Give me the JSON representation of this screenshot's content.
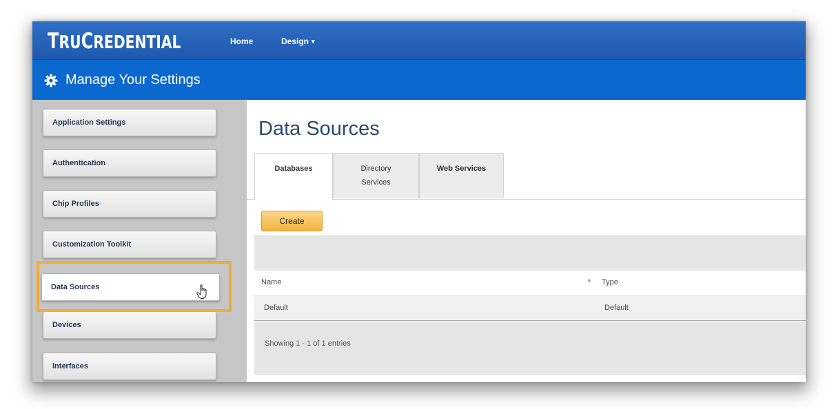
{
  "brand": {
    "prefix_big": "T",
    "part1": "RU",
    "mid_big": "C",
    "part2": "REDENTIAL"
  },
  "nav": {
    "home": "Home",
    "design": "Design",
    "design_caret": "▾"
  },
  "header": {
    "title": "Manage Your Settings",
    "icon": "gear-icon"
  },
  "sidebar": {
    "items": [
      {
        "label": "Application Settings"
      },
      {
        "label": "Authentication"
      },
      {
        "label": "Chip Profiles"
      },
      {
        "label": "Customization Toolkit"
      },
      {
        "label": "Data Sources"
      },
      {
        "label": "Devices"
      },
      {
        "label": "Interfaces"
      }
    ],
    "active_index": 4
  },
  "main": {
    "title": "Data Sources",
    "tabs": [
      {
        "label": "Databases"
      },
      {
        "label_line1": "Directory",
        "label_line2": "Services"
      },
      {
        "label": "Web Services"
      }
    ],
    "create_label": "Create",
    "table": {
      "columns": [
        "Name",
        "Type"
      ],
      "sort_indicator": "▲",
      "rows": [
        {
          "name": "Default",
          "type": "Default"
        }
      ]
    },
    "footer": "Showing 1 - 1 of 1 entries"
  },
  "colors": {
    "topbar": "#2366b9",
    "header": "#0a68cf",
    "highlight": "#f2ac33",
    "create_button": "#f5c25d",
    "title_text": "#29486e"
  }
}
